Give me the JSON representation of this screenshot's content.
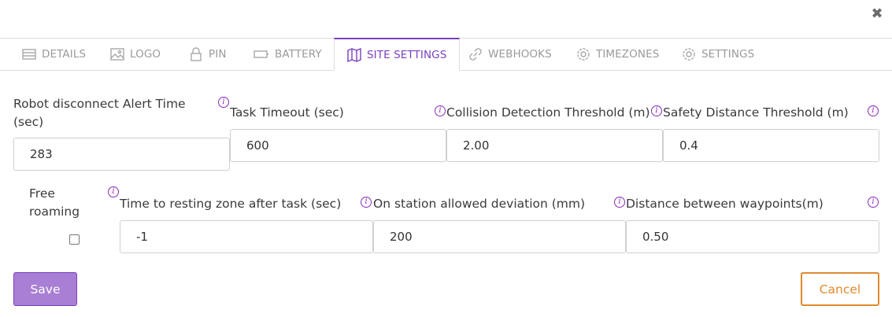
{
  "dialog": {
    "close_icon": "close-icon"
  },
  "tabs": [
    {
      "label": "DETAILS",
      "icon": "list-icon"
    },
    {
      "label": "LOGO",
      "icon": "image-icon"
    },
    {
      "label": "PIN",
      "icon": "lock-icon"
    },
    {
      "label": "BATTERY",
      "icon": "battery-icon"
    },
    {
      "label": "SITE SETTINGS",
      "icon": "map-icon",
      "active": true
    },
    {
      "label": "WEBHOOKS",
      "icon": "link-icon"
    },
    {
      "label": "TIMEZONES",
      "icon": "gear-icon"
    },
    {
      "label": "SETTINGS",
      "icon": "gear-icon"
    }
  ],
  "fields": {
    "robot_disconnect": {
      "label": "Robot disconnect Alert Time (sec)",
      "value": "283"
    },
    "task_timeout": {
      "label": "Task Timeout (sec)",
      "value": "600"
    },
    "collision_threshold": {
      "label": "Collision Detection Threshold (m)",
      "value": "2.00"
    },
    "safety_distance": {
      "label": "Safety Distance Threshold (m)",
      "value": "0.4"
    },
    "free_roaming": {
      "label": "Free roaming",
      "checked": false
    },
    "resting_zone_time": {
      "label": "Time to resting zone after task (sec)",
      "value": "-1"
    },
    "station_deviation": {
      "label": "On station allowed deviation (mm)",
      "value": "200"
    },
    "waypoint_distance": {
      "label": "Distance between waypoints(m)",
      "value": "0.50"
    }
  },
  "info_glyph": "i",
  "actions": {
    "save": "Save",
    "cancel": "Cancel"
  },
  "colors": {
    "accent": "#7b3fbf",
    "save_bg": "#a87fd4",
    "cancel": "#e08a2c"
  }
}
